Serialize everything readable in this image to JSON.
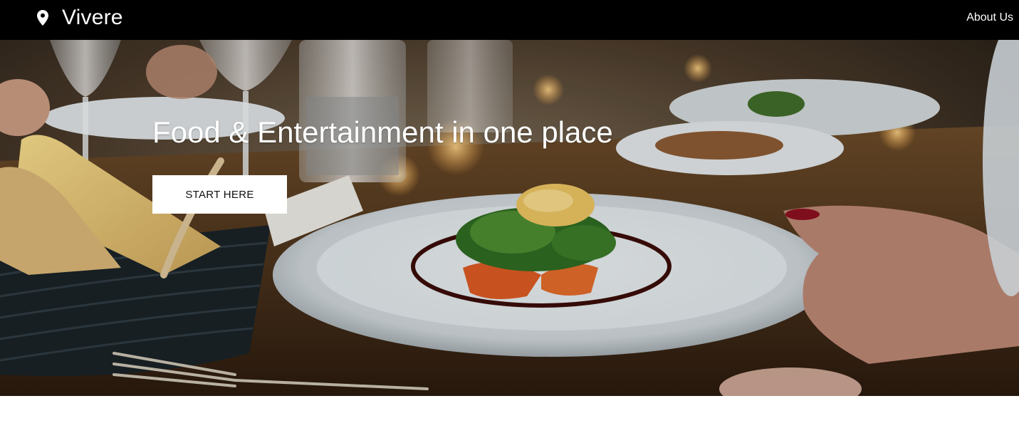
{
  "navbar": {
    "brand": "Vivere",
    "brand_icon": "map-pin-icon",
    "links": [
      "About Us"
    ]
  },
  "hero": {
    "title": "Food & Entertainment in one place",
    "cta_label": "START HERE",
    "photo_description": "restaurant table with a plated fish dish, bread basket, wine glasses and a hand holding the plate"
  },
  "colors": {
    "navbar_bg": "#000000",
    "text_on_dark": "#ffffff",
    "button_bg": "#ffffff",
    "button_text": "#111111"
  }
}
